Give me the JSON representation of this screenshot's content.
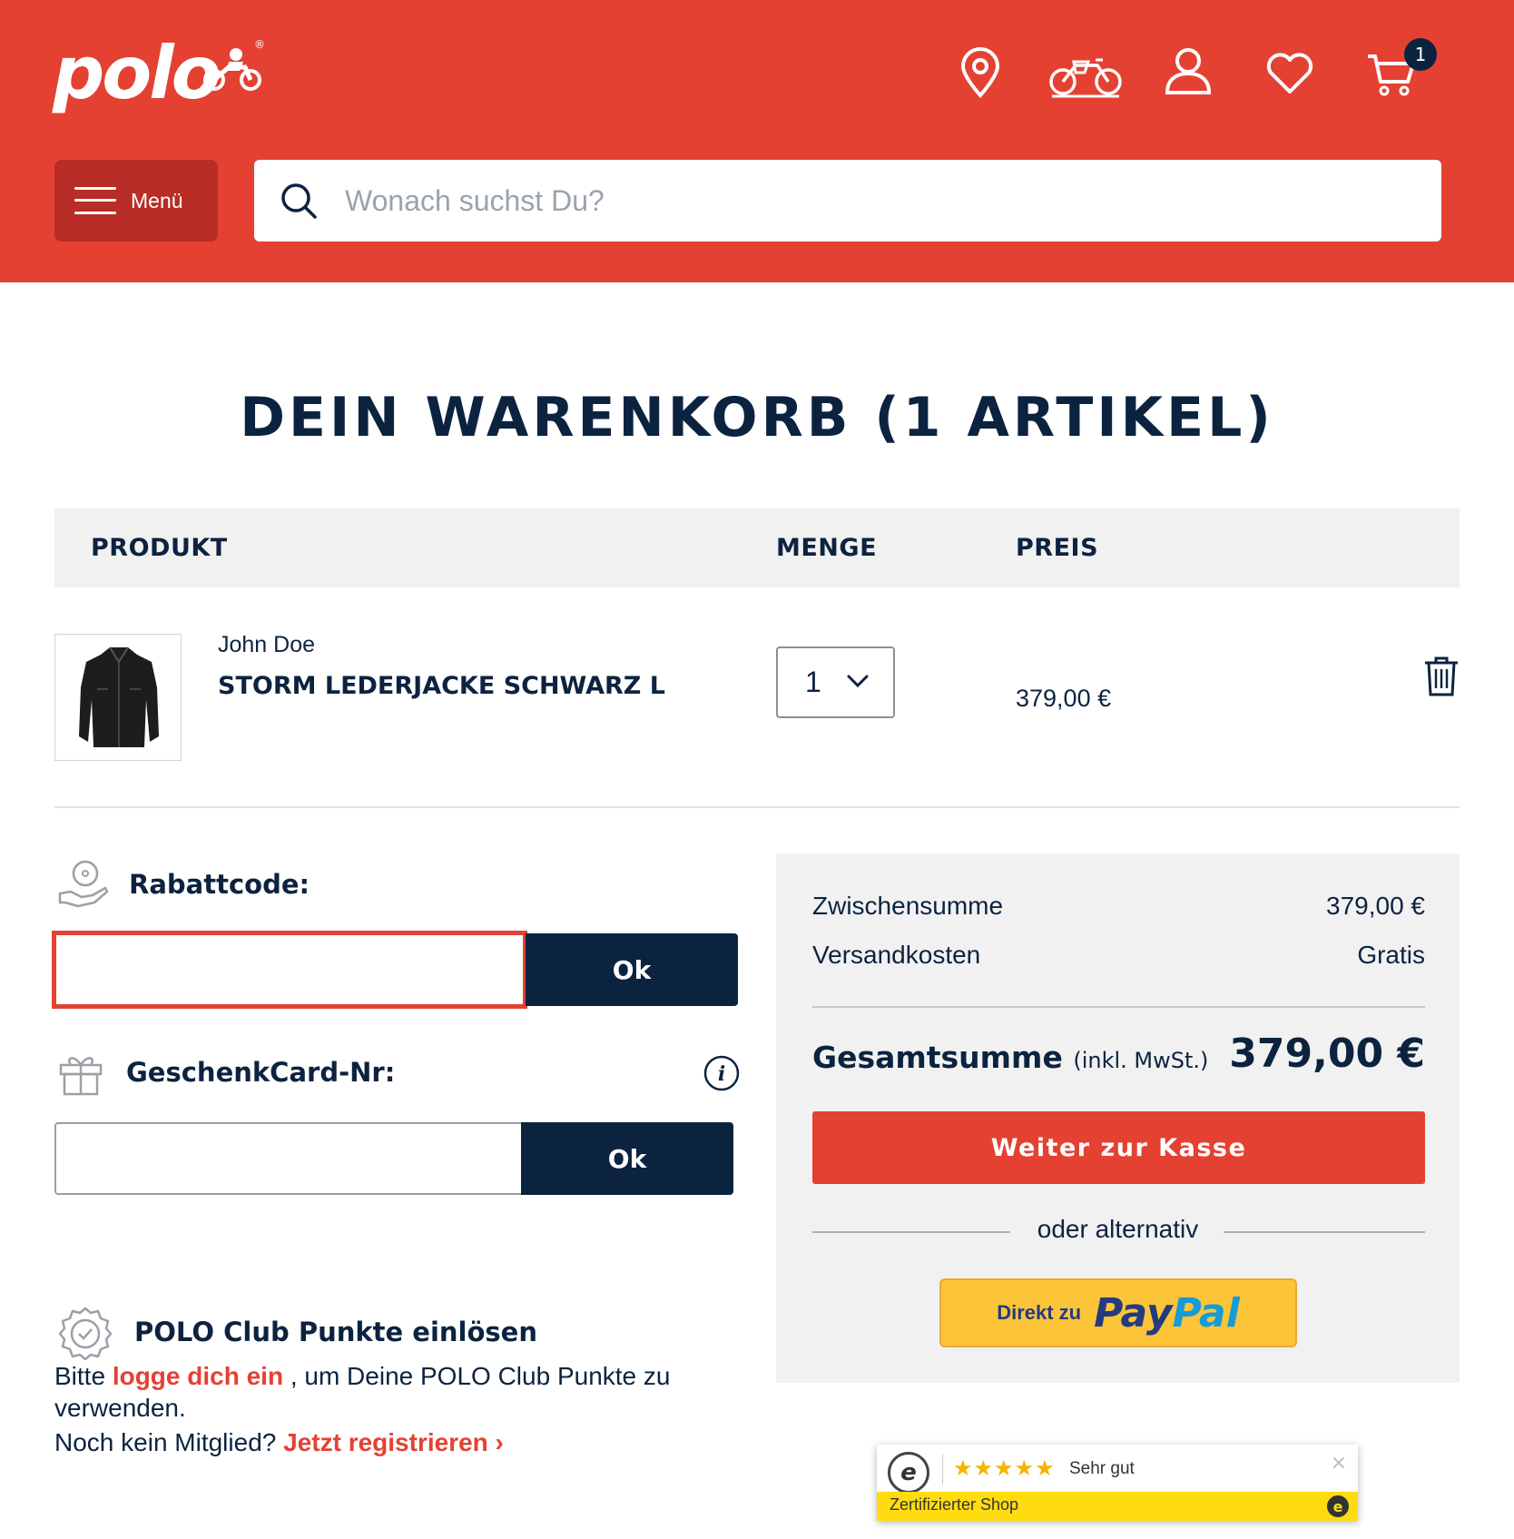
{
  "header": {
    "logo_text": "polo",
    "logo_reg": "®",
    "cart_count": "1",
    "menu_label": "Menü",
    "search_placeholder": "Wonach suchst Du?",
    "icons": [
      "location-pin-icon",
      "motorcycle-garage-icon",
      "user-account-icon",
      "heart-wishlist-icon",
      "shopping-cart-icon"
    ]
  },
  "page": {
    "title": "DEIN WARENKORB (1 ARTIKEL)"
  },
  "table": {
    "headers": [
      "PRODUKT",
      "MENGE",
      "PREIS"
    ]
  },
  "item": {
    "brand": "John Doe",
    "name": "STORM LEDERJACKE SCHWARZ L",
    "quantity": "1",
    "price": "379,00 €"
  },
  "coupon": {
    "label": "Rabattcode:",
    "value": "",
    "button": "Ok"
  },
  "giftcard": {
    "label": "GeschenkCard-Nr:",
    "value": "",
    "button": "Ok"
  },
  "club": {
    "title": "POLO Club Punkte einlösen",
    "text_before": "Bitte ",
    "login_link": "logge dich ein",
    "text_after": " , um Deine POLO Club Punkte zu verwenden.",
    "register_prefix": "Noch kein Mitglied? ",
    "register_link": "Jetzt registrieren",
    "register_arrow": "›"
  },
  "summary": {
    "subtotal_label": "Zwischensumme",
    "subtotal_value": "379,00 €",
    "shipping_label": "Versandkosten",
    "shipping_value": "Gratis",
    "total_label": "Gesamtsumme",
    "total_note": "(inkl. MwSt.)",
    "total_value": "379,00 €",
    "checkout_button": "Weiter zur Kasse",
    "alternative_text": "oder alternativ",
    "paypal_prefix": "Direkt zu",
    "paypal_pay": "Pay",
    "paypal_pal": "Pal"
  },
  "trust_badge": {
    "seal": "e",
    "stars": "★★★★★",
    "rating": "Sehr gut",
    "close": "×",
    "certified": "Zertifizierter Shop",
    "icon": "e"
  },
  "colors": {
    "brand_red": "#e44133",
    "navy": "#0c2340",
    "paypal_yellow": "#fcc439",
    "panel_gray": "#f1f1f1"
  }
}
